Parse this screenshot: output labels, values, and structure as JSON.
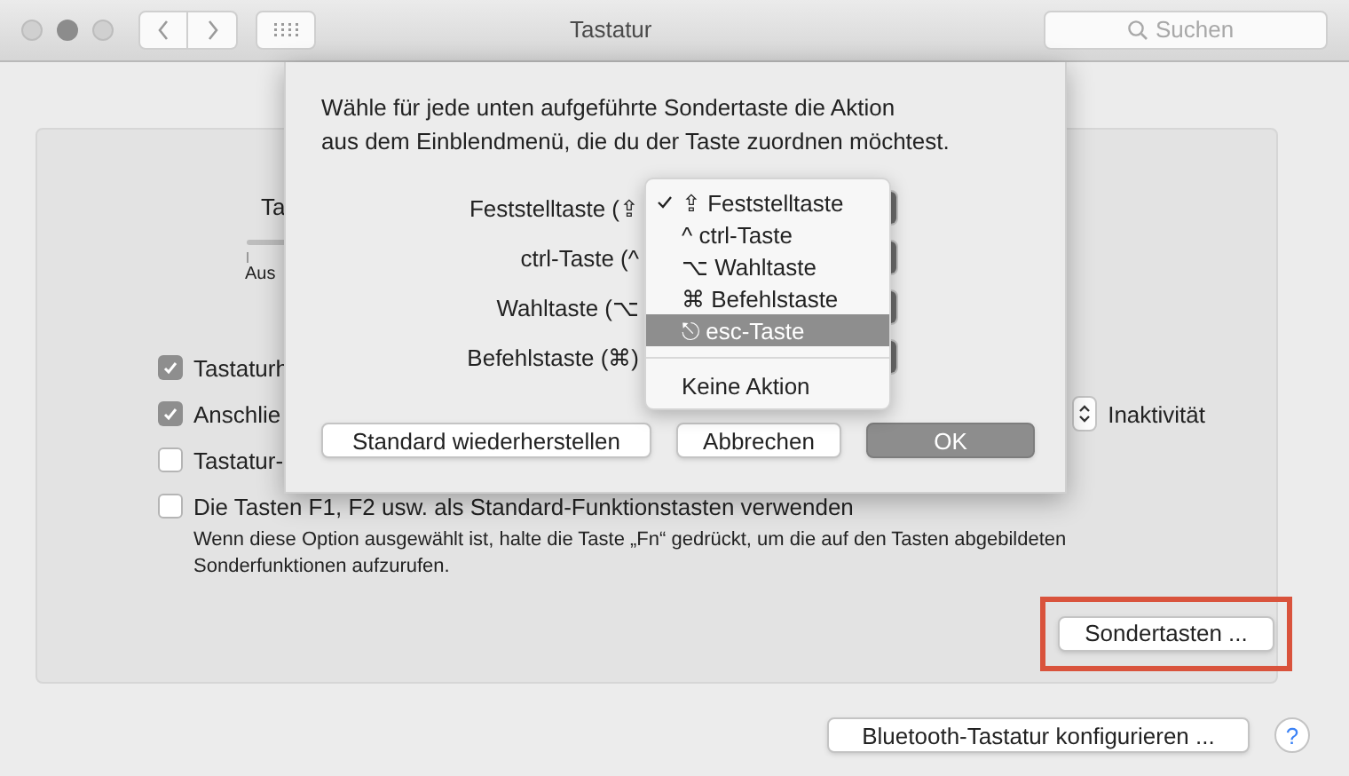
{
  "window": {
    "title": "Tastatur",
    "search": {
      "placeholder": "Suchen"
    }
  },
  "background": {
    "tab_fragment": "Ta",
    "slider_label": "Aus",
    "checkboxes": [
      {
        "label": "Tastaturh",
        "checked": true
      },
      {
        "label": "Anschlie",
        "checked": true
      },
      {
        "label": "Tastatur-",
        "checked": false
      },
      {
        "label": "Die Tasten F1, F2 usw. als Standard-Funktionstasten verwenden",
        "checked": false
      }
    ],
    "description": "Wenn diese Option ausgewählt ist, halte die Taste „Fn“ gedrückt, um die auf den Tasten abgebildeten Sonderfunktionen aufzurufen.",
    "stepper_label": "Inaktivität",
    "special_keys_button": {
      "label": "Sondertasten ...",
      "highlighted": true
    },
    "bluetooth_button": "Bluetooth-Tastatur konfigurieren ...",
    "help": "?"
  },
  "sheet": {
    "message": "Wähle für jede unten aufgeführte Sondertaste die Aktion\naus dem Einblendmenü, die du der Taste zuordnen möchtest.",
    "rows": [
      {
        "label": "Feststelltaste (⇪"
      },
      {
        "label": "ctrl-Taste (^"
      },
      {
        "label": "Wahltaste (⌥"
      },
      {
        "label": "Befehlstaste (⌘)"
      }
    ],
    "menu": {
      "items": [
        {
          "symbol": "⇪",
          "label": "Feststelltaste",
          "checked": true,
          "selected": false
        },
        {
          "symbol": "^",
          "label": "ctrl-Taste",
          "checked": false,
          "selected": false
        },
        {
          "symbol": "⌥",
          "label": "Wahltaste",
          "checked": false,
          "selected": false
        },
        {
          "symbol": "⌘",
          "label": "Befehlstaste",
          "checked": false,
          "selected": false
        },
        {
          "symbol": "⎋",
          "label": "esc-Taste",
          "checked": false,
          "selected": true
        }
      ],
      "footer_items": [
        {
          "label": "Keine Aktion",
          "selected": false
        }
      ]
    },
    "buttons": [
      {
        "label": "Standard wiederherstellen",
        "kind": "normal"
      },
      {
        "label": "Abbrechen",
        "kind": "normal"
      },
      {
        "label": "OK",
        "kind": "default"
      }
    ]
  }
}
